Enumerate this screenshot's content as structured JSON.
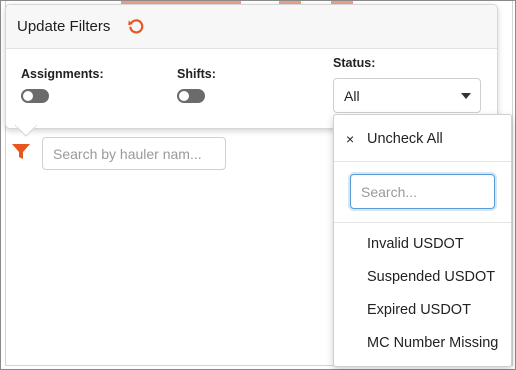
{
  "popover": {
    "title": "Update Filters",
    "reset_icon": "refresh-icon",
    "filters": {
      "assignments_label": "Assignments:",
      "assignments_enabled": false,
      "shifts_label": "Shifts:",
      "shifts_enabled": false,
      "status_label": "Status:",
      "status_value": "All"
    }
  },
  "toolbar": {
    "filter_icon": "funnel-icon",
    "hauler_search_placeholder": "Search by hauler nam..."
  },
  "status_dropdown": {
    "uncheck_all_icon": "×",
    "uncheck_all_label": "Uncheck All",
    "search_placeholder": "Search...",
    "options": [
      "Invalid USDOT",
      "Suspended USDOT",
      "Expired USDOT",
      "MC Number Missing"
    ]
  },
  "colors": {
    "accent": "#e8551f",
    "toggle_off": "#6b6b6b",
    "focus_border": "#5b9bd5"
  }
}
